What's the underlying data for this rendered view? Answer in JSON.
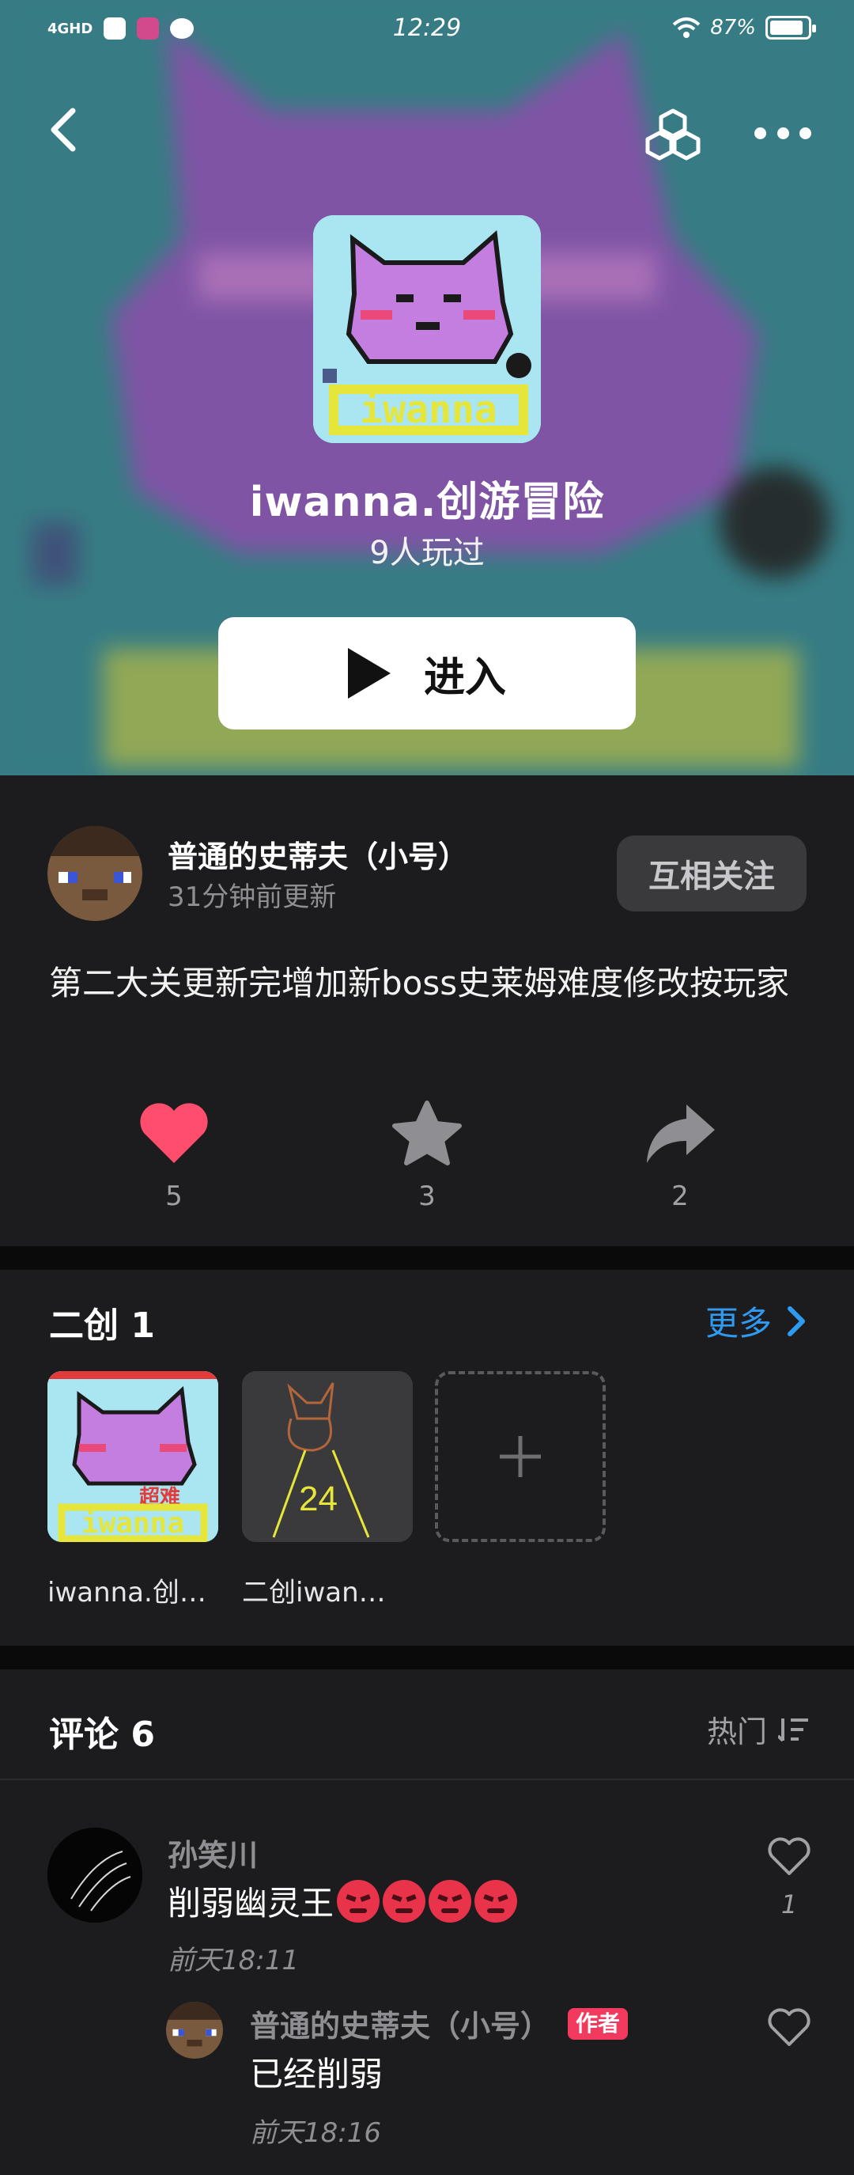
{
  "status_bar": {
    "network": "4GHD",
    "time": "12:29",
    "battery": "87%"
  },
  "game": {
    "title": "iwanna.创游冒险",
    "plays": "9人玩过",
    "enter_label": "进入",
    "icon_text": "iwanna"
  },
  "author": {
    "name": "普通的史蒂夫（小号）",
    "updated": "31分钟前更新",
    "follow_label": "互相关注",
    "description": "第二大关更新完增加新boss史莱姆难度修改按玩家"
  },
  "actions": [
    {
      "icon": "heart-icon",
      "count": "5",
      "color": "#ff4d6d"
    },
    {
      "icon": "star-icon",
      "count": "3",
      "color": "#8e8e93"
    },
    {
      "icon": "share-icon",
      "count": "2",
      "color": "#8e8e93"
    }
  ],
  "derivatives": {
    "title": "二创 1",
    "more_label": "更多",
    "items": [
      {
        "label": "iwanna.创…",
        "badge": "超难"
      },
      {
        "label": "二创iwan…",
        "number": "24"
      }
    ]
  },
  "comments": {
    "title": "评论 6",
    "sort_label": "热门",
    "items": [
      {
        "user": "孙笑川",
        "text": "削弱幽灵王",
        "time": "前天18:11",
        "likes": "1"
      }
    ],
    "reply": {
      "user": "普通的史蒂夫（小号）",
      "badge": "作者",
      "text": "已经削弱",
      "time": "前天18:16"
    }
  }
}
